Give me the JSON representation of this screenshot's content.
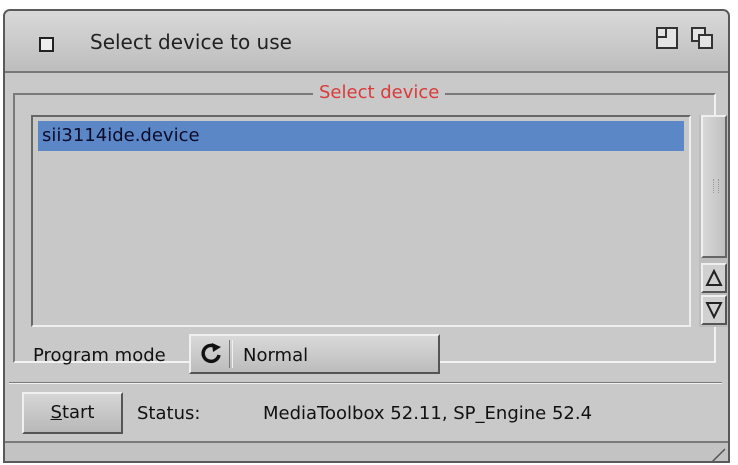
{
  "window": {
    "title": "Select device to use"
  },
  "device_group": {
    "title": "Select device",
    "devices": [
      "sii3114ide.device"
    ],
    "selected_index": 0
  },
  "program_mode": {
    "label": "Program mode",
    "value": "Normal"
  },
  "footer": {
    "start_label_first": "S",
    "start_label_rest": "tart",
    "status_label": "Status:",
    "status_value": "MediaToolbox 52.11, SP_Engine 52.4"
  },
  "icons": {
    "close": "close-gadget-icon",
    "zoom": "zoom-gadget-icon",
    "depth": "depth-gadget-icon",
    "cycle": "cycle-arrow-icon",
    "scroll_up": "arrow-up-icon",
    "scroll_down": "arrow-down-icon",
    "resize": "resize-grip-icon"
  },
  "colors": {
    "selection": "#5c87c6",
    "group_title": "#d93a3a",
    "window_bg": "#c9c9c9"
  }
}
